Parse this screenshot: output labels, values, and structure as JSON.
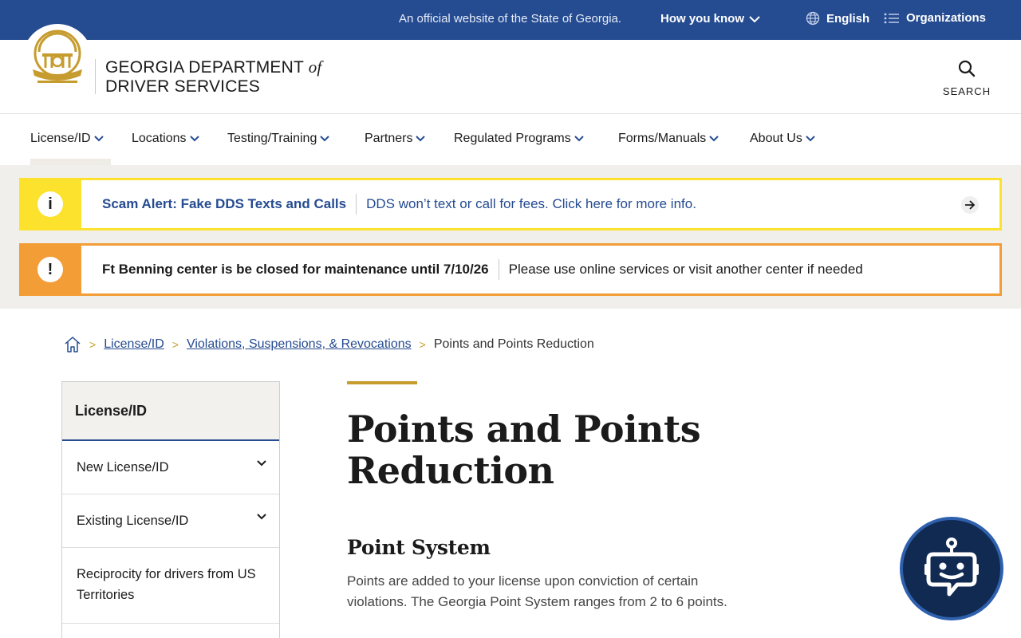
{
  "topbar": {
    "official_text": "An official website of the State of Georgia.",
    "how_you_know": "How you know",
    "language": "English",
    "organizations": "Organizations"
  },
  "header": {
    "brand_line1_prefix": "GEORGIA DEPARTMENT ",
    "brand_of": "of",
    "brand_line2": "DRIVER SERVICES",
    "search_label": "SEARCH"
  },
  "nav": {
    "items": [
      {
        "label": "License/ID"
      },
      {
        "label": "Locations"
      },
      {
        "label": "Testing/Training"
      },
      {
        "label": "Partners"
      },
      {
        "label": "Regulated Programs"
      },
      {
        "label": "Forms/Manuals"
      },
      {
        "label": "About Us"
      }
    ]
  },
  "alerts": [
    {
      "icon": "i",
      "title": "Scam Alert: Fake DDS Texts and Calls",
      "message": "DDS won’t text or call for fees. Click here for more info."
    },
    {
      "icon": "!",
      "title": "Ft Benning center is be closed for maintenance until 7/10/26",
      "message": "Please use online services or visit another center if needed"
    }
  ],
  "breadcrumb": {
    "items": [
      "License/ID",
      "Violations, Suspensions, & Revocations"
    ],
    "current": "Points and Points Reduction"
  },
  "sidebar": {
    "heading": "License/ID",
    "items": [
      {
        "label": "New License/ID"
      },
      {
        "label": "Existing License/ID"
      },
      {
        "label": "Reciprocity for drivers from US Territories"
      }
    ]
  },
  "main": {
    "title": "Points and Points Reduction",
    "section_title": "Point System",
    "paragraph": "Points are added to your license upon conviction of certain violations.  The Georgia Point System ranges from 2 to 6 points."
  },
  "colors": {
    "navy": "#254b91",
    "gold": "#c69c2e",
    "alert_yellow": "#fce22d",
    "alert_orange": "#f29d36",
    "bot_bg": "#102a52"
  }
}
